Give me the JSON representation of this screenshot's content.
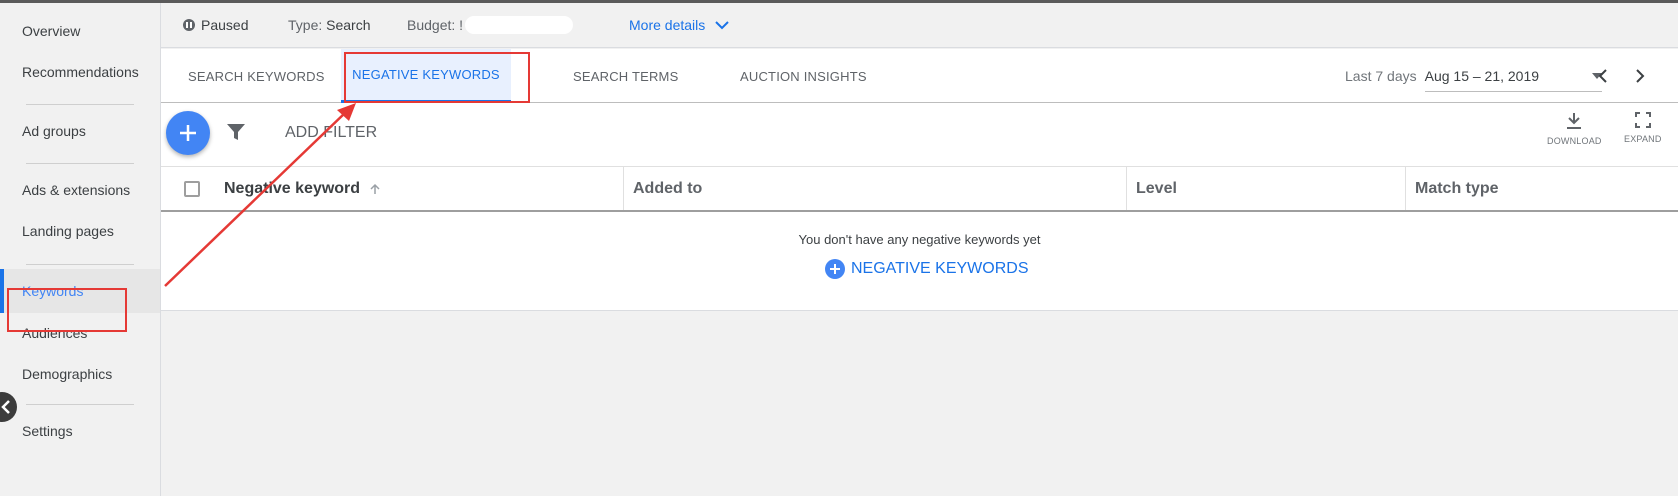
{
  "sidebar": {
    "items": [
      {
        "label": "Overview"
      },
      {
        "label": "Recommendations"
      },
      {
        "label": "Ad groups"
      },
      {
        "label": "Ads & extensions"
      },
      {
        "label": "Landing pages"
      },
      {
        "label": "Keywords"
      },
      {
        "label": "Audiences"
      },
      {
        "label": "Demographics"
      },
      {
        "label": "Settings"
      }
    ]
  },
  "status_bar": {
    "status": "Paused",
    "type_label": "Type:",
    "type_value": "Search",
    "budget_label": "Budget: !",
    "more_details": "More details"
  },
  "tabs": [
    {
      "label": "SEARCH KEYWORDS"
    },
    {
      "label": "NEGATIVE KEYWORDS"
    },
    {
      "label": "SEARCH TERMS"
    },
    {
      "label": "AUCTION INSIGHTS"
    }
  ],
  "date_range": {
    "label": "Last 7 days",
    "value": "Aug 15 – 21, 2019"
  },
  "toolbar": {
    "add_filter": "ADD FILTER",
    "download": "DOWNLOAD",
    "expand": "EXPAND"
  },
  "table": {
    "columns": [
      "Negative keyword",
      "Added to",
      "Level",
      "Match type"
    ],
    "empty_message": "You don't have any negative keywords yet",
    "empty_action": "NEGATIVE KEYWORDS"
  },
  "colors": {
    "accent": "#1a73e8",
    "fab": "#4285f4",
    "annotation": "#e53935"
  },
  "icons": [
    "pause-icon",
    "chevron-down-icon",
    "dropdown-arrow-icon",
    "chevron-left-icon",
    "chevron-right-icon",
    "plus-icon",
    "filter-icon",
    "download-icon",
    "expand-icon",
    "sort-arrow-up-icon",
    "plus-circle-icon"
  ]
}
